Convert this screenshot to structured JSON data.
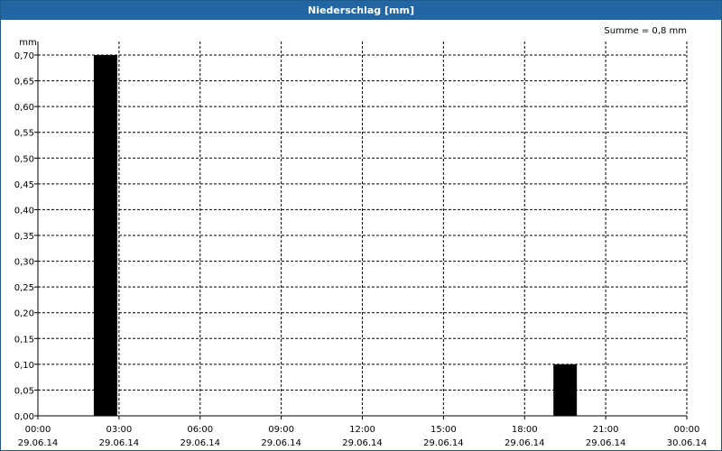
{
  "window": {
    "title": "Niederschlag [mm]"
  },
  "chart_data": {
    "type": "bar",
    "title": "Niederschlag [mm]",
    "ylabel": "mm",
    "summary": "Summe = 0,8 mm",
    "ylim": [
      0,
      0.7
    ],
    "y_ticks": [
      "0,00",
      "0,05",
      "0,10",
      "0,15",
      "0,20",
      "0,25",
      "0,30",
      "0,35",
      "0,40",
      "0,45",
      "0,50",
      "0,55",
      "0,60",
      "0,65",
      "0,70"
    ],
    "xlim_hours": [
      0,
      24
    ],
    "x_ticks": [
      {
        "time": "00:00",
        "date": "29.06.14"
      },
      {
        "time": "03:00",
        "date": "29.06.14"
      },
      {
        "time": "06:00",
        "date": "29.06.14"
      },
      {
        "time": "09:00",
        "date": "29.06.14"
      },
      {
        "time": "12:00",
        "date": "29.06.14"
      },
      {
        "time": "15:00",
        "date": "29.06.14"
      },
      {
        "time": "18:00",
        "date": "29.06.14"
      },
      {
        "time": "21:00",
        "date": "29.06.14"
      },
      {
        "time": "00:00",
        "date": "30.06.14"
      }
    ],
    "bars": [
      {
        "from": "29.06.14 02:00",
        "to": "29.06.14 03:00",
        "value": 0.7
      },
      {
        "from": "29.06.14 19:00",
        "to": "29.06.14 20:00",
        "value": 0.1
      }
    ],
    "grid": true,
    "bar_color": "#000000"
  }
}
